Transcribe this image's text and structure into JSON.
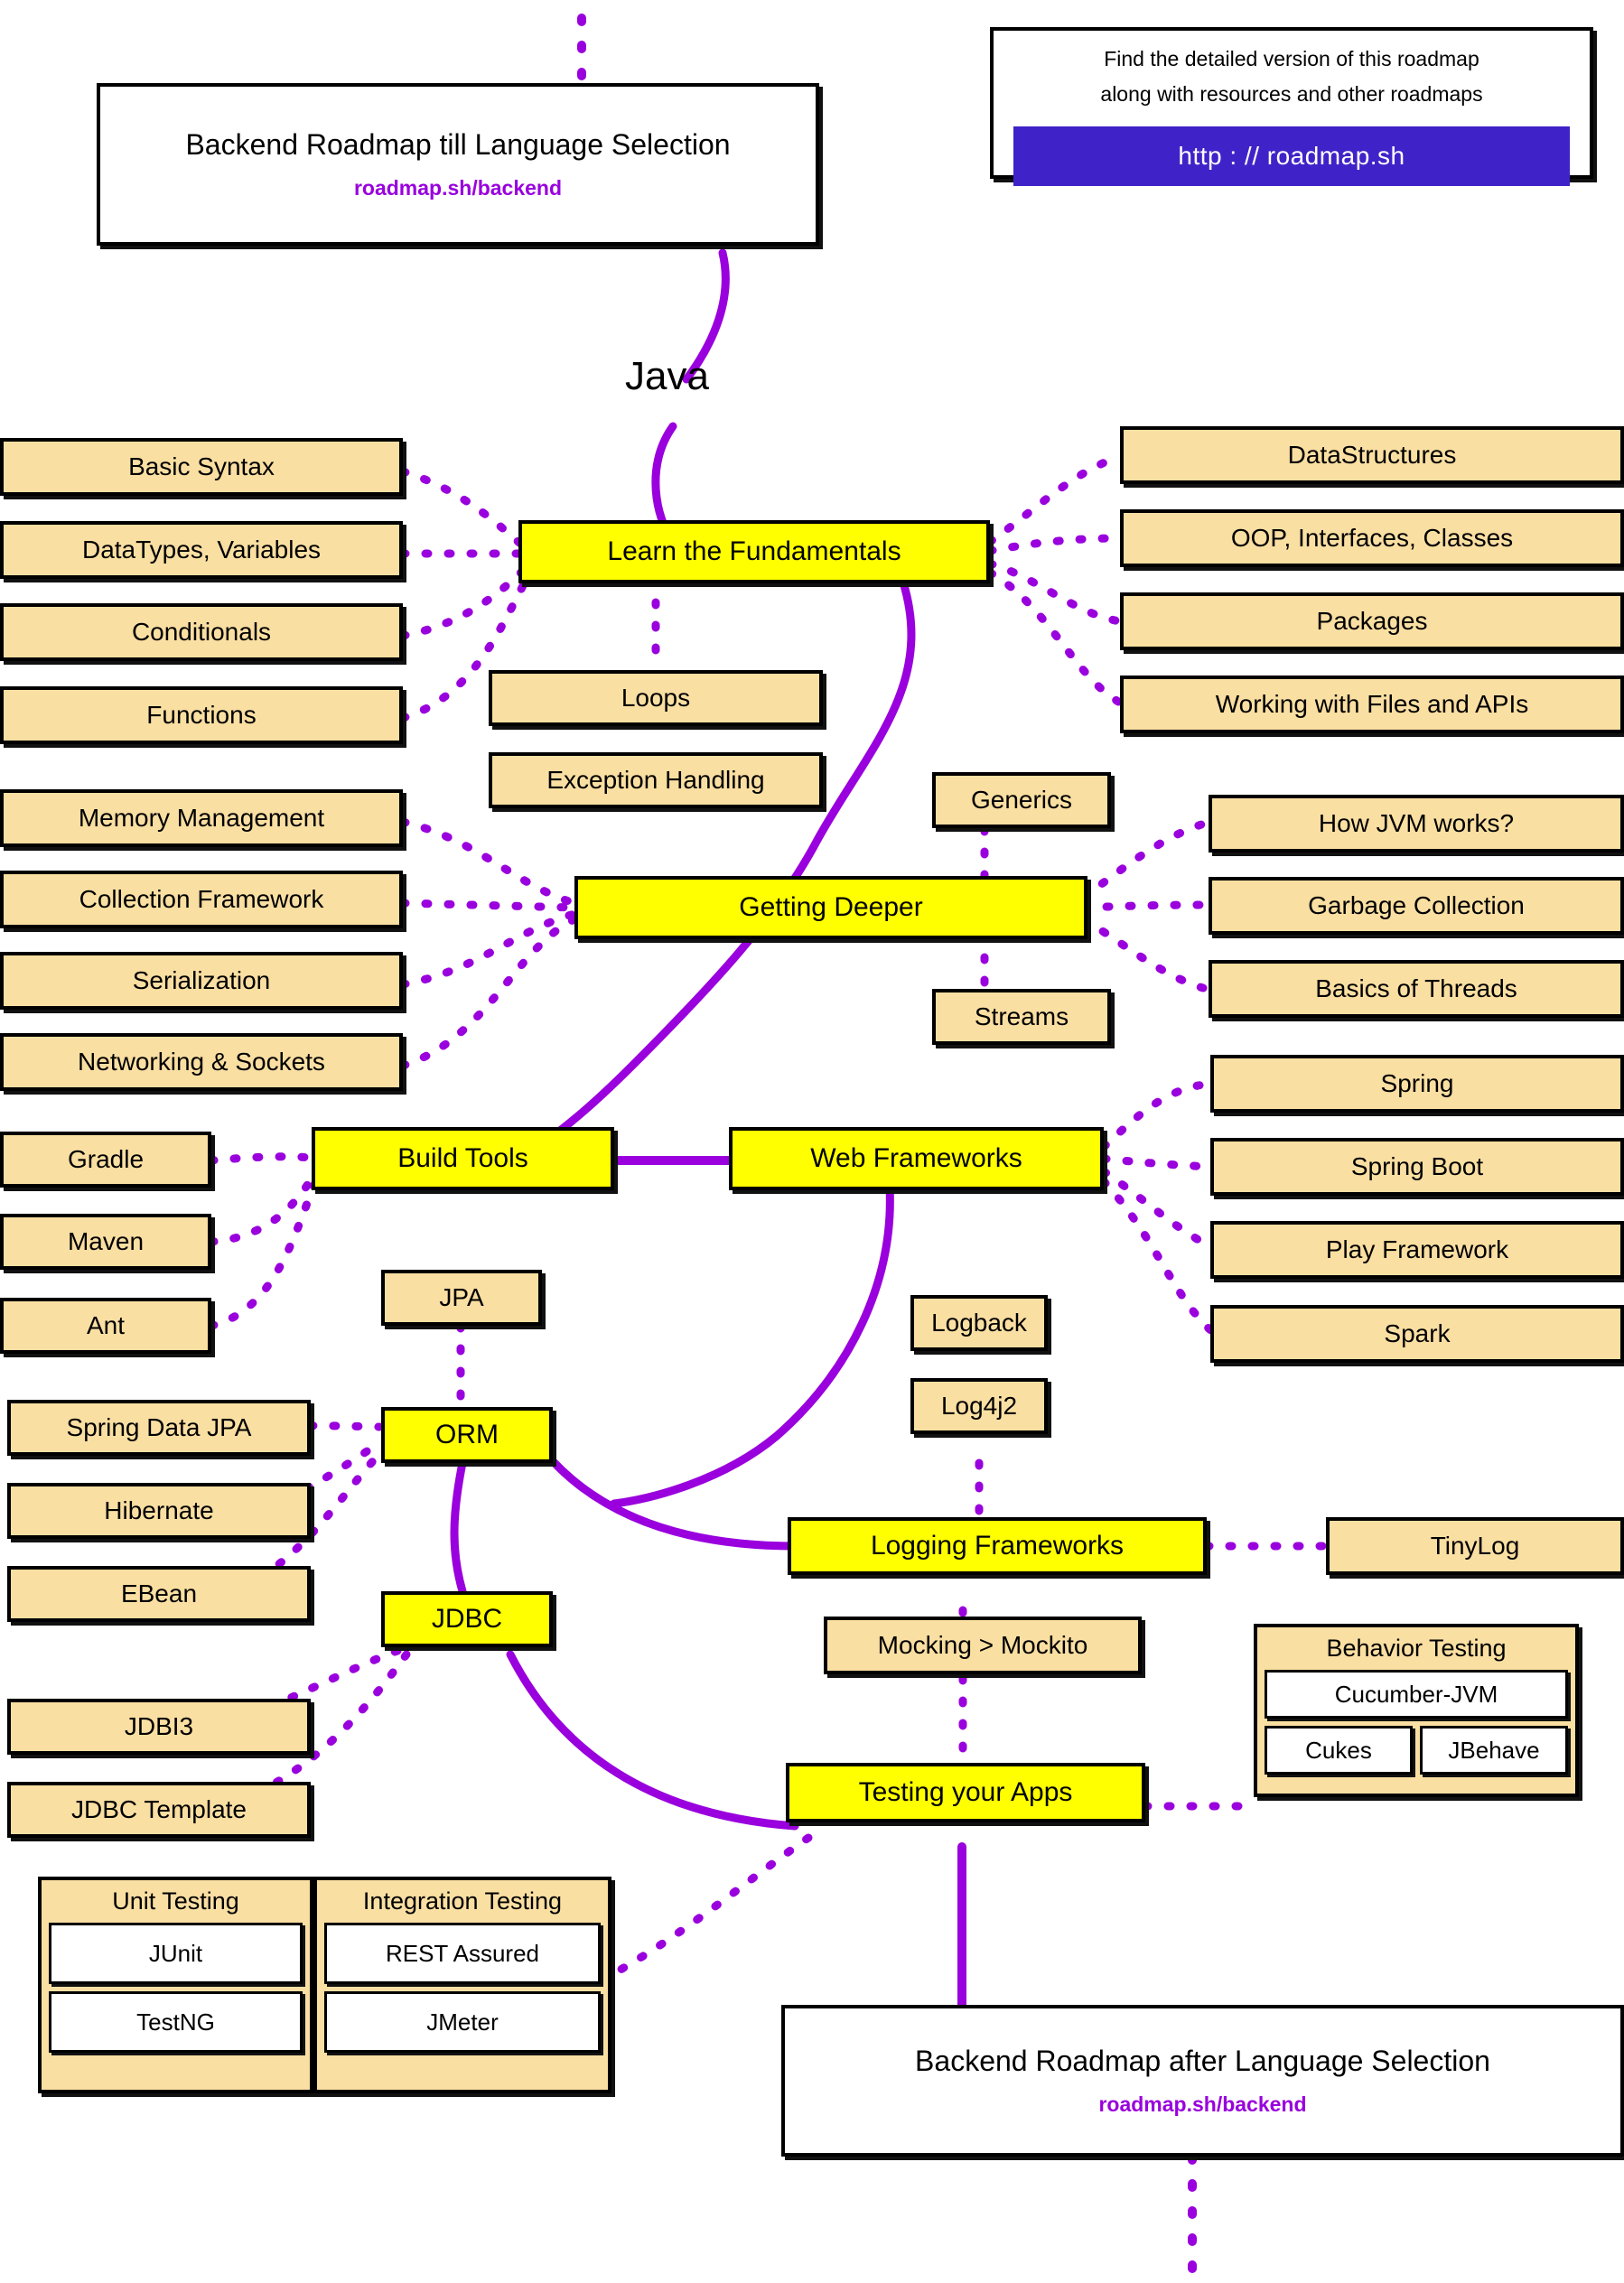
{
  "meta": {
    "colors": {
      "topic": "#ffff00",
      "subtopic": "#fadfa2",
      "chip": "#ffffff",
      "edge": "#9900dd",
      "button": "#4023c8",
      "link_text": "#9900dd"
    }
  },
  "header": {
    "title_card": {
      "title": "Backend Roadmap till Language Selection",
      "link": "roadmap.sh/backend"
    },
    "info_card": {
      "line1": "Find the detailed version of this roadmap",
      "line2": "along with resources and other roadmaps",
      "button": "http : // roadmap.sh"
    }
  },
  "root_label": "Java",
  "topics": {
    "fundamentals": "Learn the Fundamentals",
    "getting_deeper": "Getting Deeper",
    "build_tools": "Build Tools",
    "web_frameworks": "Web Frameworks",
    "orm": "ORM",
    "jdbc": "JDBC",
    "logging": "Logging Frameworks",
    "testing": "Testing your Apps"
  },
  "fundamentals_left": [
    "Basic Syntax",
    "DataTypes, Variables",
    "Conditionals",
    "Functions"
  ],
  "fundamentals_center": [
    "Loops",
    "Exception Handling"
  ],
  "fundamentals_right": [
    "DataStructures",
    "OOP, Interfaces, Classes",
    "Packages",
    "Working with Files and APIs"
  ],
  "deeper_left": [
    "Memory Management",
    "Collection Framework",
    "Serialization",
    "Networking & Sockets"
  ],
  "deeper_center": [
    "Generics",
    "Streams"
  ],
  "deeper_right": [
    "How JVM works?",
    "Garbage Collection",
    "Basics of Threads"
  ],
  "build_tools_items": [
    "Gradle",
    "Maven",
    "Ant"
  ],
  "web_framework_items": [
    "Spring",
    "Spring Boot",
    "Play Framework",
    "Spark"
  ],
  "orm_top": "JPA",
  "orm_items": [
    "Spring Data JPA",
    "Hibernate",
    "EBean"
  ],
  "jdbc_items": [
    "JDBI3",
    "JDBC Template"
  ],
  "logging_items": [
    "Logback",
    "Log4j2"
  ],
  "logging_right": "TinyLog",
  "testing_top": "Mocking  >  Mockito",
  "testing_groups": {
    "behavior": {
      "title": "Behavior Testing",
      "wide": "Cucumber-JVM",
      "small": [
        "Cukes",
        "JBehave"
      ]
    },
    "unit": {
      "title": "Unit Testing",
      "items": [
        "JUnit",
        "TestNG"
      ]
    },
    "integration": {
      "title": "Integration Testing",
      "items": [
        "REST Assured",
        "JMeter"
      ]
    }
  },
  "footer": {
    "title": "Backend Roadmap after Language Selection",
    "link": "roadmap.sh/backend"
  }
}
